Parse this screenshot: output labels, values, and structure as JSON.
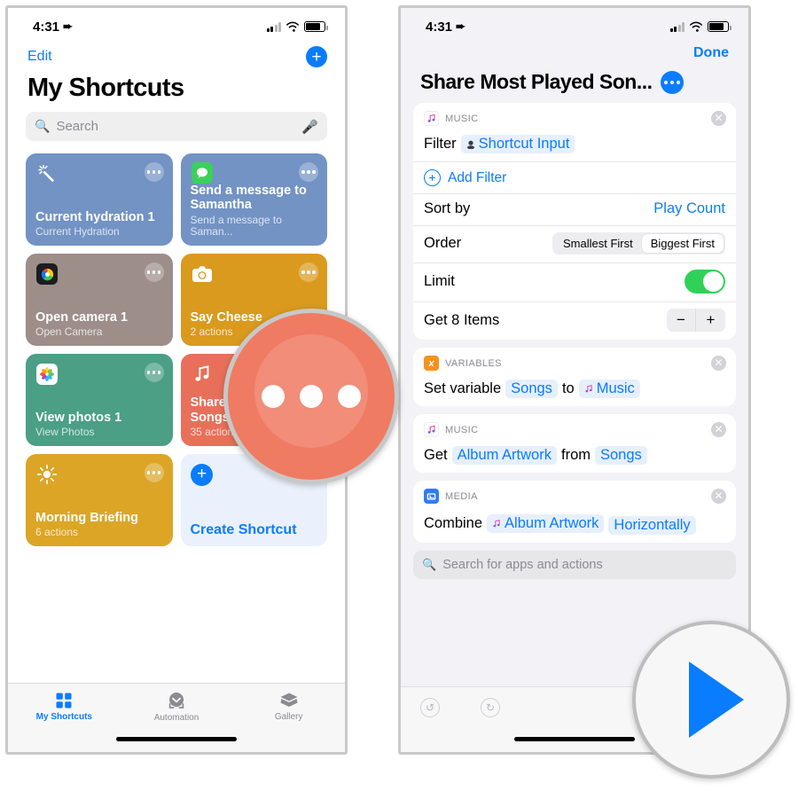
{
  "left_phone": {
    "status": {
      "time": "4:31",
      "location_icon": "location-arrow-icon",
      "battery": "battery-icon",
      "wifi": "wifi-icon",
      "cellular": "cellular-icon"
    },
    "nav": {
      "edit_label": "Edit",
      "add_icon": "plus-icon"
    },
    "page_title": "My Shortcuts",
    "search": {
      "placeholder": "Search",
      "icon": "search-icon",
      "mic_icon": "microphone-icon"
    },
    "cards": [
      {
        "title": "Current hydration 1",
        "subtitle": "Current Hydration",
        "icon": "magic-wand-icon",
        "glyph": "✦",
        "color": "#7293c4",
        "menu_icon": "ellipsis-icon"
      },
      {
        "title": "Send a message to Samantha",
        "subtitle": "Send a message to Saman...",
        "icon": "messages-app-icon",
        "glyph": "💬",
        "color": "#7293c4",
        "menu_icon": "ellipsis-icon"
      },
      {
        "title": "Open camera 1",
        "subtitle": "Open Camera",
        "icon": "halide-camera-app-icon",
        "glyph": "◉",
        "color": "#9d8e8a",
        "menu_icon": "ellipsis-icon"
      },
      {
        "title": "Say Cheese",
        "subtitle": "2 actions",
        "icon": "camera-icon",
        "glyph": "📷",
        "color": "#d99a1e",
        "menu_icon": "ellipsis-icon"
      },
      {
        "title": "View photos 1",
        "subtitle": "View Photos",
        "icon": "photos-app-icon",
        "glyph": "✿",
        "color": "#4a9f85",
        "menu_icon": "ellipsis-icon"
      },
      {
        "title": "Share Most Played Songs",
        "subtitle": "35 actions",
        "icon": "music-note-icon",
        "glyph": "♫",
        "color": "#e8705a",
        "menu_icon": "ellipsis-icon"
      },
      {
        "title": "Morning Briefing",
        "subtitle": "6 actions",
        "icon": "sun-icon",
        "glyph": "☀",
        "color": "#dca526",
        "menu_icon": "ellipsis-icon"
      }
    ],
    "create_card": {
      "label": "Create Shortcut",
      "icon": "plus-circle-icon"
    },
    "tabs": [
      {
        "label": "My Shortcuts",
        "icon": "grid-squares-icon",
        "active": true
      },
      {
        "label": "Automation",
        "icon": "clock-arrow-icon",
        "active": false
      },
      {
        "label": "Gallery",
        "icon": "layers-icon",
        "active": false
      }
    ]
  },
  "right_phone": {
    "status": {
      "time": "4:31",
      "location_icon": "location-arrow-icon"
    },
    "nav": {
      "done_label": "Done"
    },
    "title": "Share Most Played Son...",
    "title_menu_icon": "ellipsis-circle-icon",
    "action_cards": [
      {
        "category": "MUSIC",
        "badge_glyph": "♫",
        "badge_color": "#ffffff",
        "close_icon": "close-circle-icon",
        "rows": [
          {
            "type": "token",
            "label": "Filter",
            "token": "Shortcut Input",
            "token_icon": "shortcut-input-icon"
          },
          {
            "type": "add",
            "label": "Add Filter",
            "icon": "plus-circle-outline-icon"
          },
          {
            "type": "value",
            "label": "Sort by",
            "value": "Play Count"
          },
          {
            "type": "segmented",
            "label": "Order",
            "options": [
              "Smallest First",
              "Biggest First"
            ],
            "selected": "Biggest First"
          },
          {
            "type": "toggle",
            "label": "Limit",
            "on": true
          },
          {
            "type": "stepper",
            "label": "Get 8 Items",
            "minus": "−",
            "plus": "+"
          }
        ]
      },
      {
        "category": "VARIABLES",
        "badge_glyph": "x",
        "badge_color": "#f5921e",
        "close_icon": "close-circle-icon",
        "rows": [
          {
            "type": "setvar",
            "label": "Set variable",
            "token1": "Songs",
            "mid": "to",
            "token2": "Music",
            "token2_icon": "music-note-icon"
          }
        ]
      },
      {
        "category": "MUSIC",
        "badge_glyph": "♫",
        "badge_color": "#ffffff",
        "close_icon": "close-circle-icon",
        "rows": [
          {
            "type": "get",
            "label": "Get",
            "token1": "Album Artwork",
            "mid": "from",
            "token2": "Songs"
          }
        ]
      },
      {
        "category": "MEDIA",
        "badge_glyph": "▤",
        "badge_color": "#2f7cf6",
        "close_icon": "close-circle-icon",
        "rows": [
          {
            "type": "combine",
            "label": "Combine",
            "token1": "Album Artwork",
            "token1_icon": "music-note-icon",
            "token2": "Horizontally"
          }
        ]
      }
    ],
    "search": {
      "placeholder": "Search for apps and actions",
      "icon": "search-icon"
    },
    "toolbar": {
      "undo_icon": "undo-icon",
      "redo_icon": "redo-icon"
    }
  },
  "callouts": {
    "ellipsis": {
      "name": "ellipsis-callout",
      "color": "#ef7b63",
      "glyph": "ellipsis-icon"
    },
    "play": {
      "name": "play-callout",
      "color": "#0a7cff",
      "glyph": "play-triangle-icon"
    }
  }
}
